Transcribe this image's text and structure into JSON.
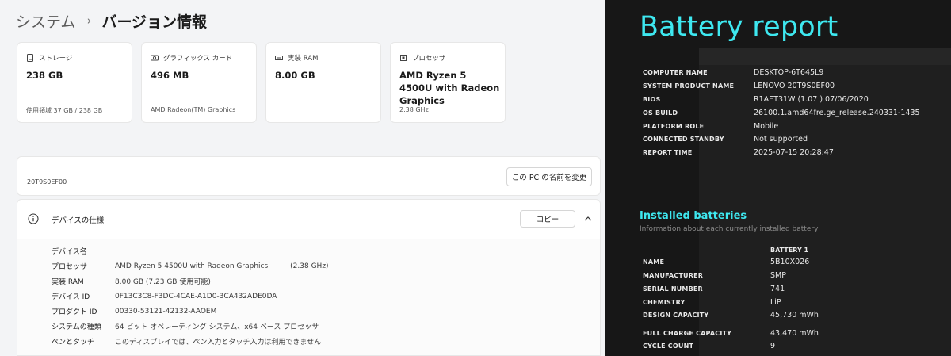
{
  "settings": {
    "breadcrumb": {
      "parent": "システム",
      "separator": "›",
      "current": "バージョン情報"
    },
    "cards": [
      {
        "icon": "storage-icon",
        "label": "ストレージ",
        "value": "238 GB",
        "sub": "使用領域 37 GB / 238 GB"
      },
      {
        "icon": "graphics-card-icon",
        "label": "グラフィックス カード",
        "value": "496 MB",
        "sub": "AMD Radeon(TM) Graphics"
      },
      {
        "icon": "ram-icon",
        "label": "実装 RAM",
        "value": "8.00 GB",
        "sub": ""
      },
      {
        "icon": "processor-icon",
        "label": "プロセッサ",
        "value": "AMD Ryzen 5 4500U with Radeon Graphics",
        "sub": "2.38 GHz"
      }
    ],
    "device_name": "20T9S0EF00",
    "rename_button": "この PC の名前を変更",
    "specs": {
      "title": "デバイスの仕様",
      "copy_button": "コピー",
      "rows": [
        {
          "label": "デバイス名",
          "value": "",
          "extra": ""
        },
        {
          "label": "プロセッサ",
          "value": "AMD Ryzen 5 4500U with Radeon Graphics",
          "extra": "(2.38 GHz)"
        },
        {
          "label": "実装 RAM",
          "value": "8.00 GB (7.23 GB 使用可能)",
          "extra": ""
        },
        {
          "label": "デバイス ID",
          "value": "0F13C3C8-F3DC-4CAE-A1D0-3CA432ADE0DA",
          "extra": ""
        },
        {
          "label": "プロダクト ID",
          "value": "00330-53121-42132-AAOEM",
          "extra": ""
        },
        {
          "label": "システムの種類",
          "value": "64 ビット オペレーティング システム、x64 ベース プロセッサ",
          "extra": ""
        },
        {
          "label": "ペンとタッチ",
          "value": "このディスプレイでは、ペン入力とタッチ入力は利用できません",
          "extra": ""
        }
      ]
    }
  },
  "battery_report": {
    "title": "Battery report",
    "system_info": [
      {
        "key": "COMPUTER NAME",
        "value": "DESKTOP-6T645L9"
      },
      {
        "key": "SYSTEM PRODUCT NAME",
        "value": "LENOVO 20T9S0EF00"
      },
      {
        "key": "BIOS",
        "value": "R1AET31W (1.07 ) 07/06/2020"
      },
      {
        "key": "OS BUILD",
        "value": "26100.1.amd64fre.ge_release.240331-1435"
      },
      {
        "key": "PLATFORM ROLE",
        "value": "Mobile"
      },
      {
        "key": "CONNECTED STANDBY",
        "value": "Not supported"
      },
      {
        "key": "REPORT TIME",
        "value": "2025-07-15  20:28:47"
      }
    ],
    "installed": {
      "title": "Installed batteries",
      "subtitle": "Information about each currently installed battery",
      "column": "BATTERY 1",
      "rows": [
        {
          "key": "NAME",
          "value": "5B10X026"
        },
        {
          "key": "MANUFACTURER",
          "value": "SMP"
        },
        {
          "key": "SERIAL NUMBER",
          "value": "741"
        },
        {
          "key": "CHEMISTRY",
          "value": "LiP"
        },
        {
          "key": "DESIGN CAPACITY",
          "value": "45,730 mWh"
        },
        {
          "key": "FULL CHARGE CAPACITY",
          "value": "43,470 mWh"
        },
        {
          "key": "CYCLE COUNT",
          "value": "9"
        }
      ]
    }
  },
  "colors": {
    "report_accent": "#3ee8f0",
    "report_bg": "#171717",
    "settings_bg": "#f3f4f6"
  }
}
